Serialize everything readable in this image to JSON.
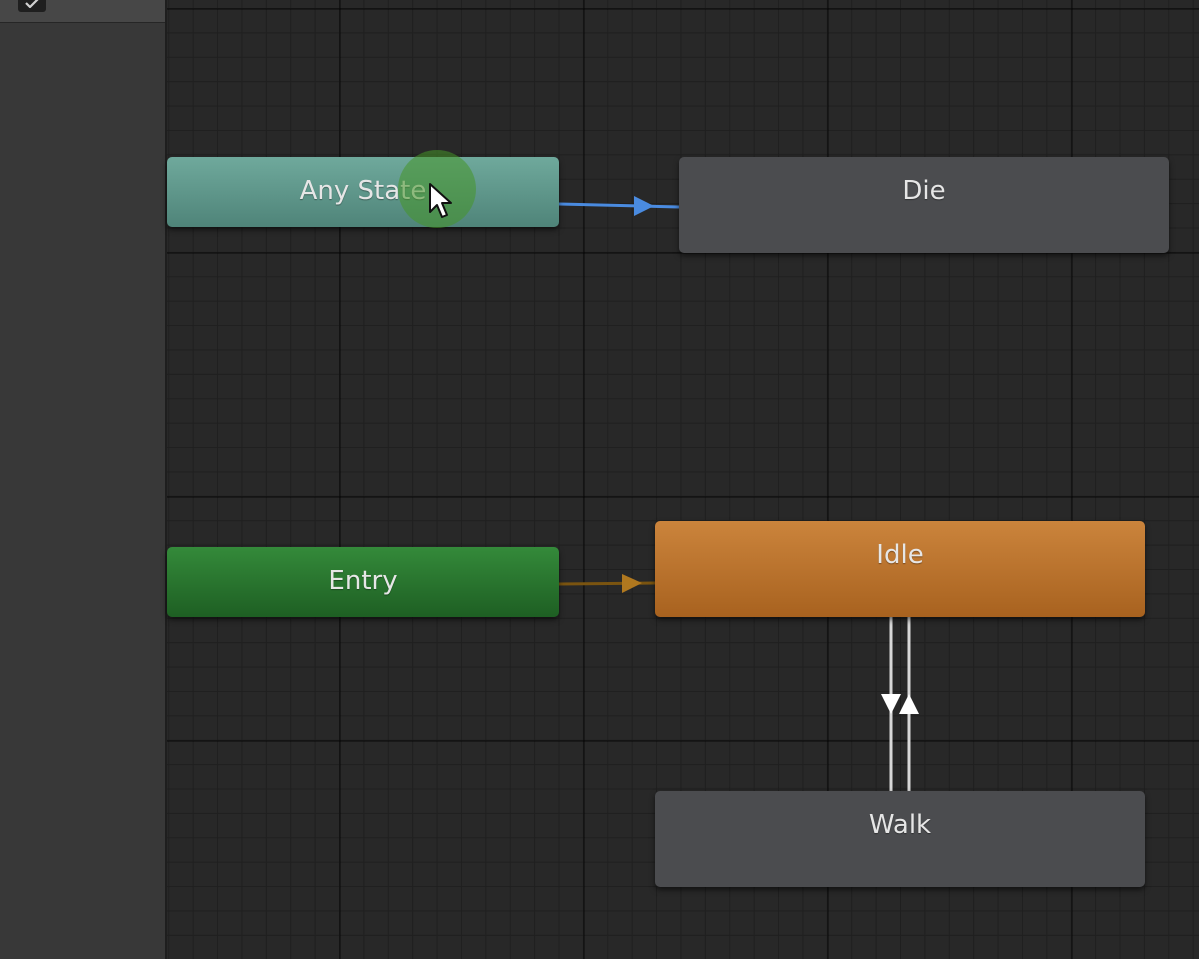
{
  "states": {
    "any_state": "Any State",
    "entry": "Entry",
    "die": "Die",
    "idle": "Idle",
    "walk": "Walk"
  },
  "colors": {
    "any_state": "#5f9a8d",
    "entry": "#2a7a2f",
    "default_state": "#bd7530",
    "state": "#4b4c4f",
    "transition_any": "#4a8be0",
    "transition_entry": "#b0781f",
    "transition_state": "#e0e0e0",
    "grid_background": "#282828"
  },
  "icons": {
    "toolbar_check": "check-icon",
    "cursor": "mouse-pointer-icon"
  }
}
